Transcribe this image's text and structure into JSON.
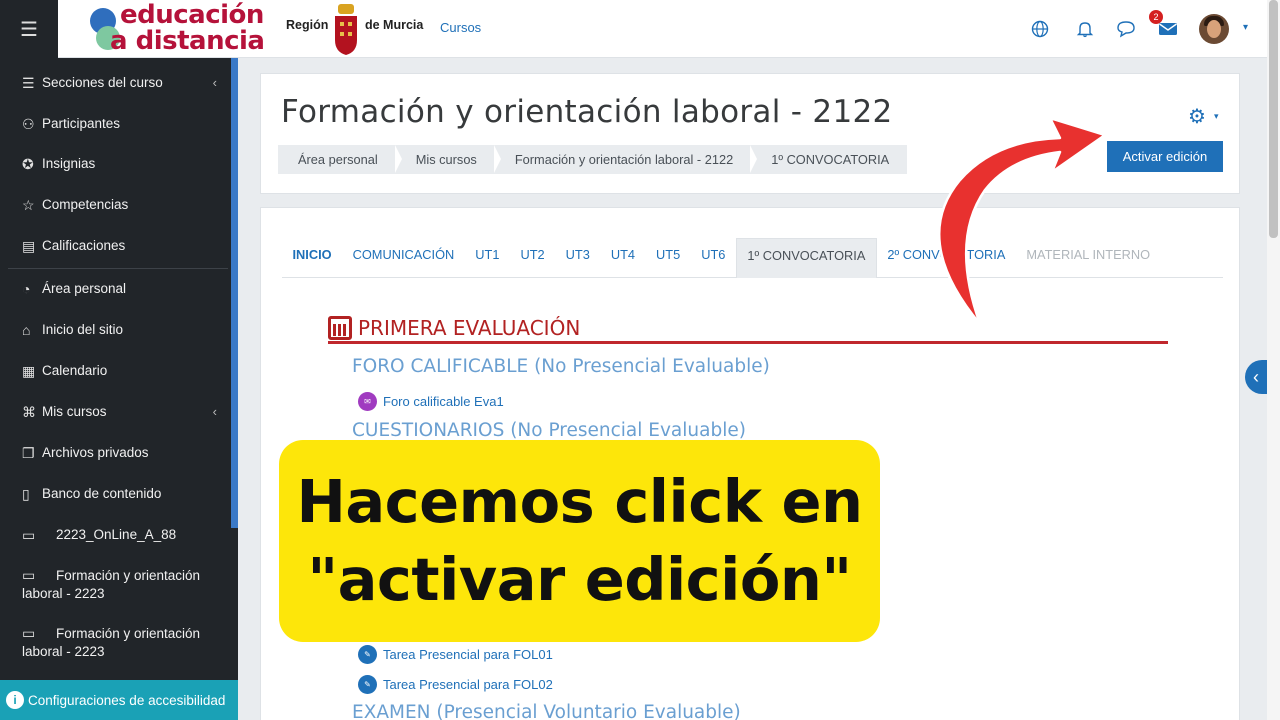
{
  "sidebar": {
    "items": [
      {
        "icon": "list-icon",
        "label": "Secciones del curso",
        "chevron": true
      },
      {
        "icon": "participants-icon",
        "label": "Participantes"
      },
      {
        "icon": "badge-icon",
        "label": "Insignias"
      },
      {
        "icon": "star-icon",
        "label": "Competencias"
      },
      {
        "icon": "grades-icon",
        "label": "Calificaciones"
      },
      {
        "icon": "dashboard-icon",
        "label": "Área personal"
      },
      {
        "icon": "home-icon",
        "label": "Inicio del sitio"
      },
      {
        "icon": "calendar-icon",
        "label": "Calendario"
      },
      {
        "icon": "mortarboard-icon",
        "label": "Mis cursos",
        "chevron": true
      },
      {
        "icon": "files-icon",
        "label": "Archivos privados"
      },
      {
        "icon": "clipboard-icon",
        "label": "Banco de contenido"
      },
      {
        "icon": "folder-icon",
        "label": "2223_OnLine_A_88"
      },
      {
        "icon": "folder-icon",
        "label": "Formación y orientación laboral - 2223"
      },
      {
        "icon": "folder-icon",
        "label": "Formación y orientación laboral - 2223"
      }
    ],
    "accessibility": "Configuraciones de accesibilidad"
  },
  "header": {
    "logo_line1": "educación",
    "logo_line2": "a distancia",
    "region": "Región",
    "murcia": "de Murcia",
    "cursos": "Cursos",
    "notification_count": "2"
  },
  "course": {
    "title": "Formación y orientación laboral - 2122",
    "breadcrumb": [
      "Área personal",
      "Mis cursos",
      "Formación y orientación laboral - 2122",
      "1º CONVOCATORIA"
    ],
    "edit_button": "Activar edición"
  },
  "tabs": [
    "INICIO",
    "COMUNICACIÓN",
    "UT1",
    "UT2",
    "UT3",
    "UT4",
    "UT5",
    "UT6",
    "1º CONVOCATORIA",
    "2º CONVOCATORIA",
    "MATERIAL INTERNO"
  ],
  "section": {
    "title": "PRIMERA EVALUACIÓN",
    "subheads": [
      "FORO CALIFICABLE (No Presencial Evaluable)",
      "CUESTIONARIOS (No Presencial Evaluable)",
      "EXAMEN (Presencial Voluntario Evaluable)"
    ],
    "activities": [
      "Foro calificable Eva1",
      "Tarea Presencial para FOL01",
      "Tarea Presencial para FOL02"
    ]
  },
  "overlay": {
    "line1": "Hacemos click en",
    "line2": "\"activar edición\""
  },
  "colors": {
    "accent": "#1f70b8",
    "sidebar_bg": "#212529",
    "section_red": "#b22222",
    "overlay_yellow": "#fde60a",
    "arrow_red": "#e8312f"
  }
}
